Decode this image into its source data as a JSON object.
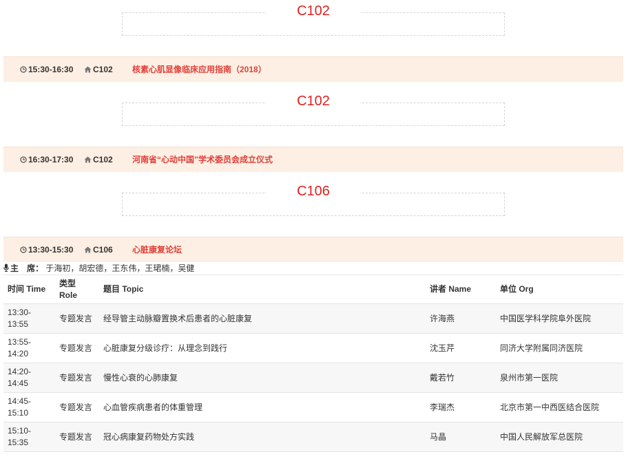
{
  "blocks": [
    {
      "room": "C102",
      "session": {
        "time": "15:30-16:30",
        "room": "C102",
        "title": "核素心肌显像临床应用指南（2018）"
      }
    },
    {
      "room": "C102",
      "session": {
        "time": "16:30-17:30",
        "room": "C102",
        "title": "河南省“心动中国”学术委员会成立仪式"
      }
    },
    {
      "room": "C106",
      "session": {
        "time": "13:30-15:30",
        "room": "C106",
        "title": "心脏康复论坛"
      }
    }
  ],
  "chair": {
    "label": "主　席：",
    "names": "于海初，胡宏德，王东伟，王珺楠，吴健"
  },
  "table": {
    "headers": [
      "时间 Time",
      "类型 Role",
      "题目 Topic",
      "讲者 Name",
      "单位 Org"
    ],
    "rows": [
      {
        "time": "13:30-13:55",
        "role": "专题发言",
        "topic": "经导管主动脉瓣置换术后患者的心脏康复",
        "name": "许海燕",
        "org": "中国医学科学院阜外医院"
      },
      {
        "time": "13:55-14:20",
        "role": "专题发言",
        "topic": "心脏康复分级诊疗：从理念到践行",
        "name": "沈玉芹",
        "org": "同济大学附属同济医院"
      },
      {
        "time": "14:20-14:45",
        "role": "专题发言",
        "topic": "慢性心衰的心肺康复",
        "name": "戴若竹",
        "org": "泉州市第一医院"
      },
      {
        "time": "14:45-15:10",
        "role": "专题发言",
        "topic": "心血管疾病患者的体重管理",
        "name": "李瑞杰",
        "org": "北京市第一中西医结合医院"
      },
      {
        "time": "15:10-15:35",
        "role": "专题发言",
        "topic": "冠心病康复药物处方实践",
        "name": "马晶",
        "org": "中国人民解放军总医院"
      }
    ]
  }
}
